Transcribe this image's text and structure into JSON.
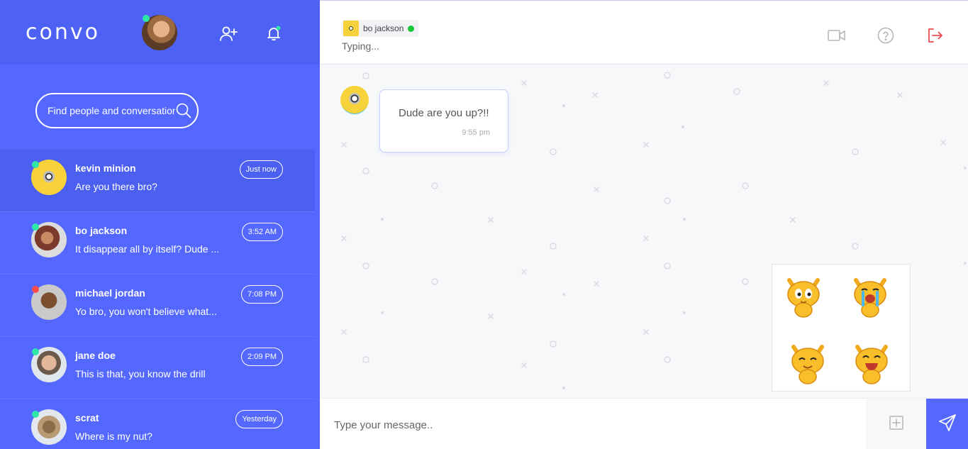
{
  "app": {
    "logo": "convo"
  },
  "sidebar": {
    "search_placeholder": "Find people and conversations",
    "conversations": [
      {
        "name": "kevin minion",
        "preview": "Are you there bro?",
        "time": "Just now",
        "status": "online"
      },
      {
        "name": "bo jackson",
        "preview": "It disappear all by itself? Dude ...",
        "time": "3:52 AM",
        "status": "online"
      },
      {
        "name": "michael jordan",
        "preview": "Yo bro, you won't believe what...",
        "time": "7:08 PM",
        "status": "busy"
      },
      {
        "name": "jane doe",
        "preview": "This is that, you know the drill",
        "time": "2:09 PM",
        "status": "online"
      },
      {
        "name": "scrat",
        "preview": "Where is my nut?",
        "time": "Yesterday",
        "status": "online"
      }
    ]
  },
  "chat": {
    "contact_name": "bo jackson",
    "typing_status": "Typing...",
    "messages": [
      {
        "text": "Dude are you up?!!",
        "time": "9:55 pm"
      }
    ],
    "input_placeholder": "Type your message.."
  },
  "icons": {
    "add_user": "add-user-icon",
    "notifications": "bell-icon",
    "search": "search-icon",
    "video_call": "video-camera-icon",
    "help": "question-icon",
    "logout": "logout-icon",
    "attach": "plus-square-icon",
    "send": "paper-plane-icon"
  },
  "colors": {
    "primary": "#5468ff",
    "online": "#2ee6a6",
    "busy": "#ff4d4d",
    "logout": "#e84c4c"
  }
}
